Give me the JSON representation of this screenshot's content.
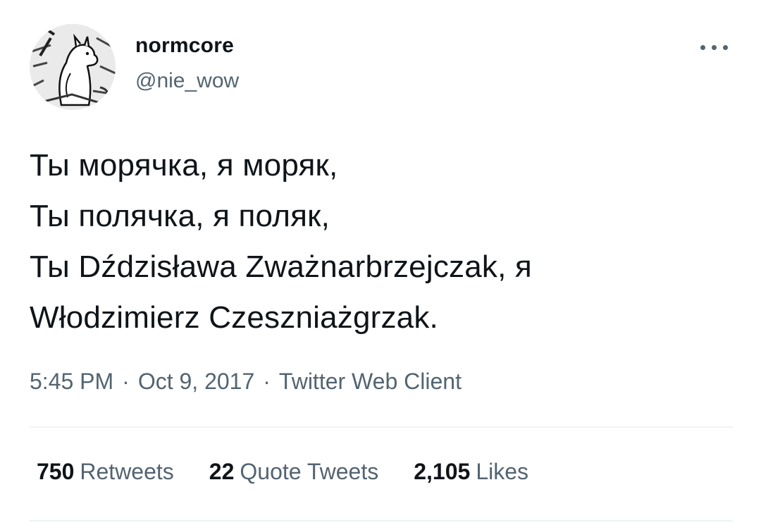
{
  "author": {
    "display_name": "normcore",
    "handle": "@nie_wow",
    "avatar_icon": "moomin-avatar"
  },
  "more_icon": "more-dots-icon",
  "tweet": {
    "lines": [
      "Ты морячка, я моряк,",
      "Ты полячка, я поляк,",
      "Ты Dździsława Zważnarbrzejczak, я",
      "Włodzimierz Czeszniażgrzak."
    ]
  },
  "meta": {
    "time": "5:45 PM",
    "separator": "·",
    "date": "Oct 9, 2017",
    "client": "Twitter Web Client"
  },
  "stats": {
    "retweets": {
      "count": "750",
      "label": "Retweets"
    },
    "quotes": {
      "count": "22",
      "label": "Quote Tweets"
    },
    "likes": {
      "count": "2,105",
      "label": "Likes"
    }
  },
  "colors": {
    "text": "#0f1419",
    "secondary": "#536471",
    "divider": "#eff3f4"
  }
}
